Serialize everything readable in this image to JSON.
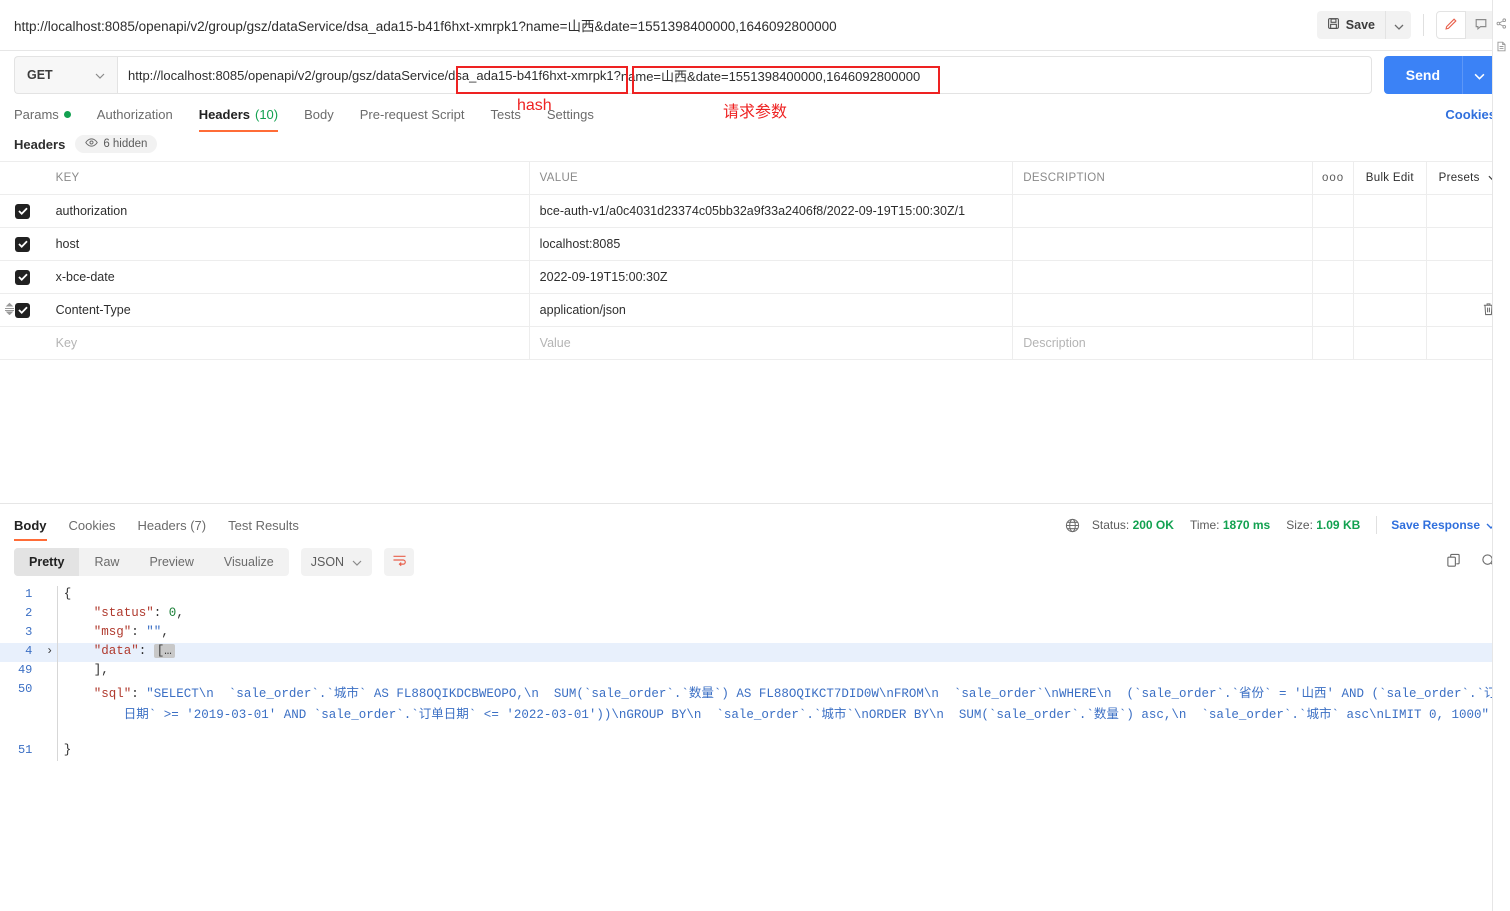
{
  "window": {
    "tab_url": "http://localhost:8085/openapi/v2/group/gsz/dataService/dsa_ada15-b41f6hxt-xmrpk1?name=山西&date=1551398400000,1646092800000"
  },
  "top_actions": {
    "save_label": "Save",
    "save_icon": "floppy-disk-icon",
    "save_caret_icon": "chevron-down-icon",
    "edit_icon": "pencil-icon",
    "comment_icon": "comment-icon"
  },
  "request": {
    "method": "GET",
    "method_caret_icon": "chevron-down-icon",
    "url_prefix": "http://localhost:8085/openapi/v2/group/gsz/dataService/",
    "url_hash": "dsa_ada15-b41f6hxt-xmrpk1",
    "url_qmark": "?",
    "url_query": "name=山西&date=1551398400000,1646092800000",
    "send_label": "Send",
    "send_caret_icon": "chevron-down-icon"
  },
  "annotations": {
    "hash_label": "hash",
    "query_label": "请求参数",
    "color": "#ee2222"
  },
  "request_tabs": [
    {
      "label": "Params",
      "badge": "dot",
      "active": false
    },
    {
      "label": "Authorization",
      "badge": "",
      "active": false
    },
    {
      "label": "Headers",
      "badge": "(10)",
      "active": true
    },
    {
      "label": "Body",
      "badge": "",
      "active": false
    },
    {
      "label": "Pre-request Script",
      "badge": "",
      "active": false
    },
    {
      "label": "Tests",
      "badge": "",
      "active": false
    },
    {
      "label": "Settings",
      "badge": "",
      "active": false
    }
  ],
  "cookies_link": "Cookies",
  "headers_section": {
    "title": "Headers",
    "hidden_pill": "6 hidden",
    "eye_icon": "eye-icon",
    "columns": {
      "key": "KEY",
      "value": "VALUE",
      "description": "DESCRIPTION",
      "dots": "ooo",
      "bulk_edit": "Bulk Edit",
      "presets": "Presets"
    },
    "rows": [
      {
        "checked": true,
        "key": "authorization",
        "value": "bce-auth-v1/a0c4031d23374c05bb32a9f33a2406f8/2022-09-19T15:00:30Z/1",
        "description": ""
      },
      {
        "checked": true,
        "key": "host",
        "value": "localhost:8085",
        "description": ""
      },
      {
        "checked": true,
        "key": "x-bce-date",
        "value": "2022-09-19T15:00:30Z",
        "description": ""
      },
      {
        "checked": true,
        "key": "Content-Type",
        "value": "application/json",
        "description": ""
      }
    ],
    "placeholder_row": {
      "key": "Key",
      "value": "Value",
      "description": "Description"
    }
  },
  "response": {
    "tabs": [
      {
        "label": "Body",
        "active": true
      },
      {
        "label": "Cookies",
        "active": false
      },
      {
        "label": "Headers (7)",
        "active": false
      },
      {
        "label": "Test Results",
        "active": false
      }
    ],
    "status_prefix": "Status:",
    "status_value": "200 OK",
    "time_prefix": "Time:",
    "time_value": "1870 ms",
    "size_prefix": "Size:",
    "size_value": "1.09 KB",
    "save_response": "Save Response",
    "globe_icon": "globe-icon",
    "view_modes": [
      {
        "label": "Pretty",
        "active": true
      },
      {
        "label": "Raw",
        "active": false
      },
      {
        "label": "Preview",
        "active": false
      },
      {
        "label": "Visualize",
        "active": false
      }
    ],
    "format": "JSON",
    "wrap_icon": "word-wrap-icon",
    "copy_icon": "copy-icon",
    "search_icon": "search-icon"
  },
  "code": {
    "lines": [
      {
        "no": "1",
        "fold": "",
        "selected": false,
        "segments": [
          {
            "t": "{",
            "c": "punct"
          }
        ]
      },
      {
        "no": "2",
        "fold": "",
        "selected": false,
        "segments": [
          {
            "t": "    ",
            "c": "punct"
          },
          {
            "t": "\"status\"",
            "c": "k"
          },
          {
            "t": ": ",
            "c": "punct"
          },
          {
            "t": "0",
            "c": "num"
          },
          {
            "t": ",",
            "c": "punct"
          }
        ]
      },
      {
        "no": "3",
        "fold": "",
        "selected": false,
        "segments": [
          {
            "t": "    ",
            "c": "punct"
          },
          {
            "t": "\"msg\"",
            "c": "k"
          },
          {
            "t": ": ",
            "c": "punct"
          },
          {
            "t": "\"\"",
            "c": "str"
          },
          {
            "t": ",",
            "c": "punct"
          }
        ]
      },
      {
        "no": "4",
        "fold": "›",
        "selected": true,
        "segments": [
          {
            "t": "    ",
            "c": "punct"
          },
          {
            "t": "\"data\"",
            "c": "k"
          },
          {
            "t": ": ",
            "c": "punct"
          },
          {
            "t": "[…",
            "c": "fold"
          }
        ]
      },
      {
        "no": "49",
        "fold": "",
        "selected": false,
        "segments": [
          {
            "t": "    ",
            "c": "punct"
          },
          {
            "t": "],",
            "c": "punct"
          }
        ]
      },
      {
        "no": "50",
        "fold": "",
        "selected": false,
        "segments": [
          {
            "t": "    ",
            "c": "punct"
          },
          {
            "t": "\"sql\"",
            "c": "k"
          },
          {
            "t": ": ",
            "c": "punct"
          },
          {
            "t": "\"SELECT\\n  `sale_order`.`城市` AS FL88OQIKDCBWEOPO,\\n  SUM(`sale_order`.`数量`) AS FL88OQIKCT7DID0W\\nFROM\\n  `sale_order`\\nWHERE\\n  (`sale_order`.`省份` = '山西' AND (`sale_order`.`订单",
            "c": "str"
          }
        ]
      },
      {
        "no": "",
        "fold": "",
        "selected": false,
        "segments": [
          {
            "t": "        ",
            "c": "punct"
          },
          {
            "t": "日期` >= '2019-03-01' AND `sale_order`.`订单日期` <= '2022-03-01'))\\nGROUP BY\\n  `sale_order`.`城市`\\nORDER BY\\n  SUM(`sale_order`.`数量`) asc,\\n  `sale_order`.`城市` asc\\nLIMIT 0, 1000\"",
            "c": "str"
          }
        ]
      },
      {
        "no": "",
        "fold": "",
        "selected": false,
        "segments": [
          {
            "t": " ",
            "c": "punct"
          }
        ]
      },
      {
        "no": "51",
        "fold": "",
        "selected": false,
        "segments": [
          {
            "t": "}",
            "c": "punct"
          }
        ]
      }
    ]
  },
  "right_rail": {
    "share_icon": "share-icon",
    "docs_icon": "document-icon"
  }
}
